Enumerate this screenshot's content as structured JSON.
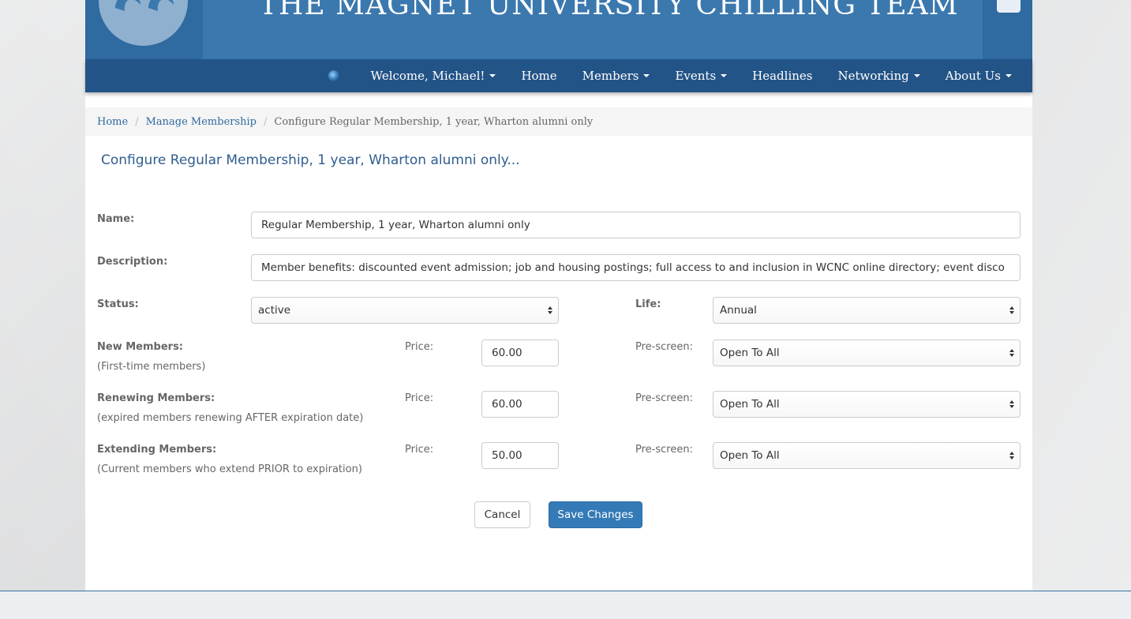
{
  "header": {
    "site_title": "THE MAGNET UNIVERSITY CHILLING TEAM"
  },
  "nav": {
    "items": [
      {
        "label": "Welcome, Michael!",
        "dropdown": true
      },
      {
        "label": "Home",
        "dropdown": false
      },
      {
        "label": "Members",
        "dropdown": true
      },
      {
        "label": "Events",
        "dropdown": true
      },
      {
        "label": "Headlines",
        "dropdown": false
      },
      {
        "label": "Networking",
        "dropdown": true
      },
      {
        "label": "About Us",
        "dropdown": true
      }
    ]
  },
  "breadcrumb": {
    "home": "Home",
    "manage": "Manage Membership",
    "current": "Configure Regular Membership, 1 year, Wharton alumni only"
  },
  "form": {
    "title": "Configure Regular Membership, 1 year, Wharton alumni only...",
    "name_label": "Name:",
    "name_value": "Regular Membership, 1 year, Wharton alumni only",
    "description_label": "Description:",
    "description_value": "Member benefits: discounted event admission; job and housing postings; full access to and inclusion in WCNC online directory; event disco",
    "status_label": "Status:",
    "status_value": "active",
    "life_label": "Life:",
    "life_value": "Annual",
    "price_label": "Price:",
    "prescreen_label": "Pre-screen:",
    "rows": [
      {
        "title": "New Members:",
        "subtitle": "(First-time members)",
        "price": "60.00",
        "prescreen": "Open To All"
      },
      {
        "title": "Renewing Members:",
        "subtitle": "(expired members renewing AFTER expiration date)",
        "price": "60.00",
        "prescreen": "Open To All"
      },
      {
        "title": "Extending Members:",
        "subtitle": "(Current members who extend PRIOR to expiration)",
        "price": "50.00",
        "prescreen": "Open To All"
      }
    ],
    "cancel_label": "Cancel",
    "save_label": "Save Changes"
  },
  "colors": {
    "header_blue": "#3b78ae",
    "nav_blue": "#235487",
    "primary_button": "#337ab7",
    "title_text": "#2f5d8e"
  },
  "icons": {
    "logo": "logo-icon",
    "twitter": "twitter-icon",
    "nav_badge": "globe-icon",
    "select_arrows": "select-arrows-icon"
  }
}
